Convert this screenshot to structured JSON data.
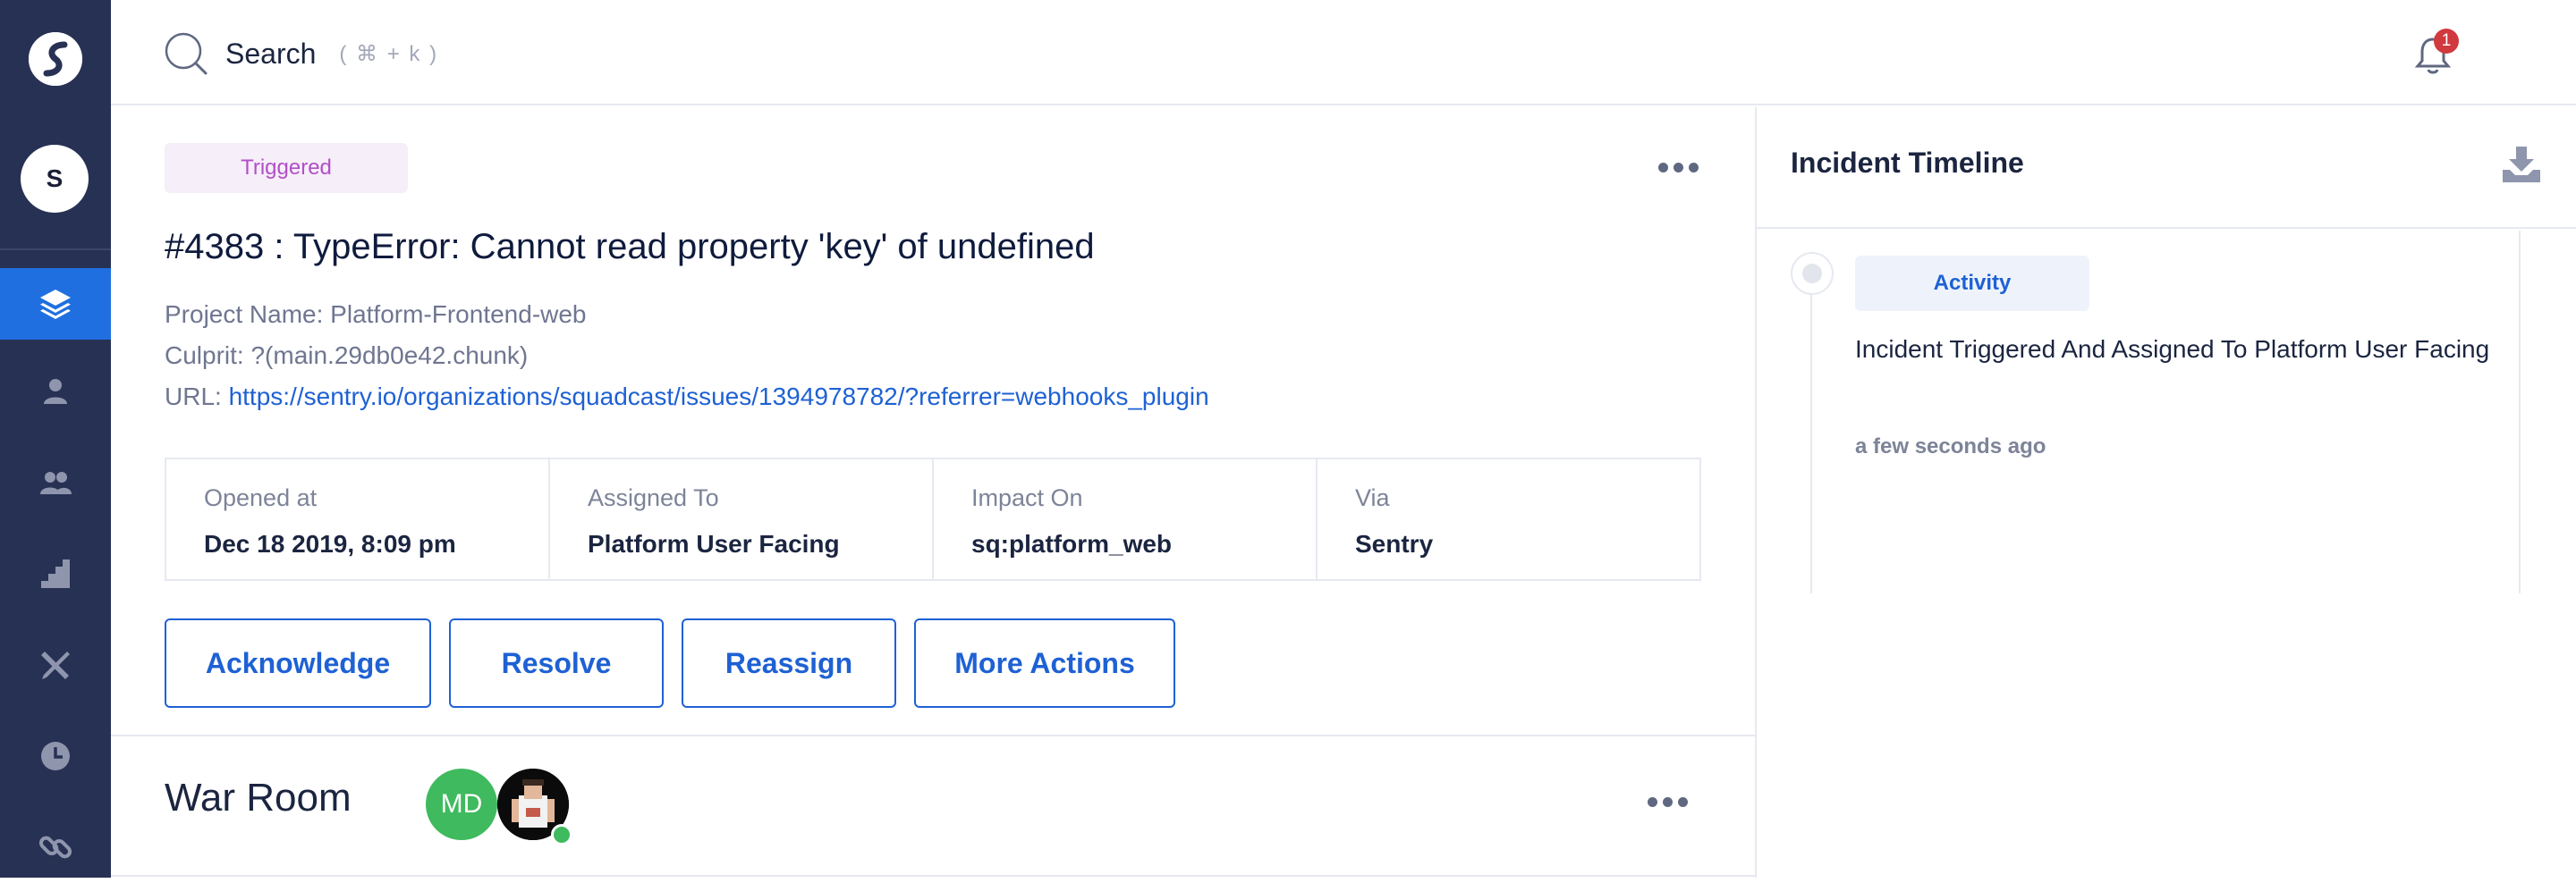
{
  "sidebar": {
    "org_initial": "S",
    "nav": [
      {
        "icon": "layers-icon",
        "active": true
      },
      {
        "icon": "user-icon",
        "active": false
      },
      {
        "icon": "team-icon",
        "active": false
      },
      {
        "icon": "analytics-icon",
        "active": false
      },
      {
        "icon": "tools-icon",
        "active": false
      },
      {
        "icon": "clock-icon",
        "active": false
      },
      {
        "icon": "link-icon",
        "active": false
      }
    ]
  },
  "topbar": {
    "search_label": "Search",
    "search_hint": "( ⌘ + k )",
    "notification_count": "1"
  },
  "incident": {
    "status": "Triggered",
    "title": "#4383 : TypeError: Cannot read property 'key' of undefined",
    "project_line": "Project Name: Platform-Frontend-web",
    "culprit_line": "Culprit: ?(main.29db0e42.chunk)",
    "url_label": "URL: ",
    "url": "https://sentry.io/organizations/squadcast/issues/1394978782/?referrer=webhooks_plugin",
    "info": [
      {
        "label": "Opened at",
        "value": "Dec 18 2019, 8:09 pm"
      },
      {
        "label": "Assigned To",
        "value": "Platform User Facing"
      },
      {
        "label": "Impact On",
        "value": "sq:platform_web"
      },
      {
        "label": "Via",
        "value": "Sentry"
      }
    ],
    "actions": {
      "acknowledge": "Acknowledge",
      "resolve": "Resolve",
      "reassign": "Reassign",
      "more": "More Actions"
    }
  },
  "war_room": {
    "title": "War Room",
    "member_initials": "MD"
  },
  "timeline": {
    "title": "Incident Timeline",
    "entries": [
      {
        "type": "Activity",
        "text": "Incident Triggered And Assigned To Platform User Facing",
        "time": "a few seconds ago"
      }
    ]
  },
  "colors": {
    "sidebar_bg": "#273154",
    "active_nav": "#1f6fe0",
    "accent": "#1e61d4",
    "triggered": "#b14fc8",
    "badge": "#d0393e",
    "online": "#3fba5e"
  }
}
